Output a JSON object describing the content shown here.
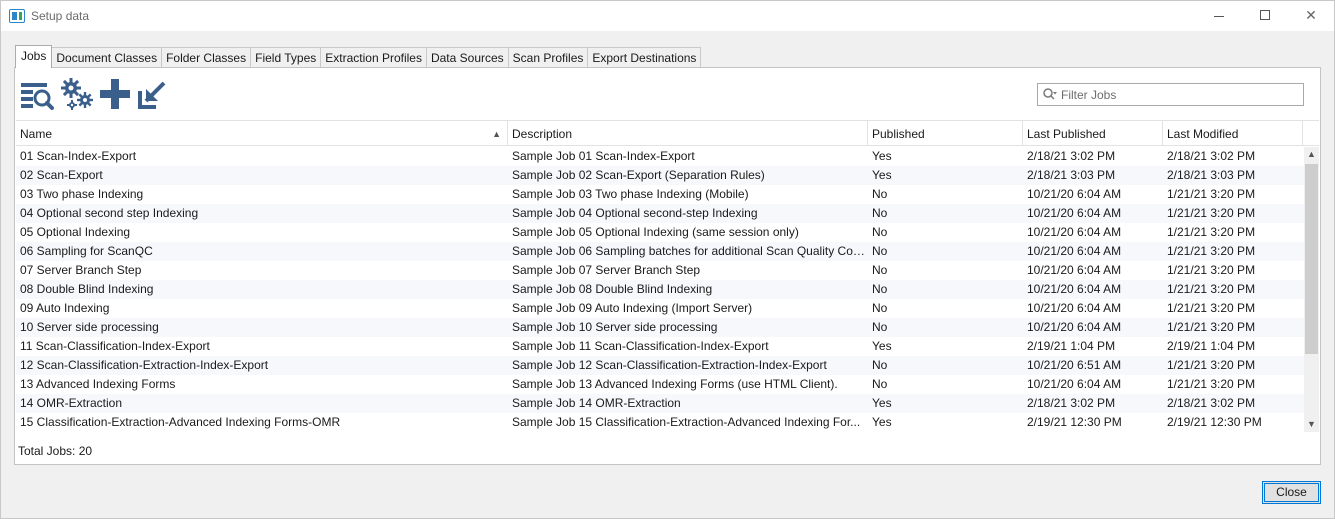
{
  "window": {
    "title": "Setup data"
  },
  "tabs": [
    {
      "label": "Jobs",
      "active": true
    },
    {
      "label": "Document Classes",
      "active": false
    },
    {
      "label": "Folder Classes",
      "active": false
    },
    {
      "label": "Field Types",
      "active": false
    },
    {
      "label": "Extraction Profiles",
      "active": false
    },
    {
      "label": "Data Sources",
      "active": false
    },
    {
      "label": "Scan Profiles",
      "active": false
    },
    {
      "label": "Export Destinations",
      "active": false
    }
  ],
  "toolbar": {
    "icons": [
      "search-list-icon",
      "settings-gears-icon",
      "add-plus-icon",
      "export-arrow-icon"
    ],
    "accent_color": "#3a5f8a"
  },
  "filter": {
    "placeholder": "Filter Jobs",
    "value": ""
  },
  "grid": {
    "columns": [
      "Name",
      "Description",
      "Published",
      "Last Published",
      "Last Modified"
    ],
    "sorted_column": "Name",
    "sort_direction": "ascending",
    "rows": [
      [
        "01 Scan-Index-Export",
        "Sample Job 01 Scan-Index-Export",
        "Yes",
        "2/18/21 3:02 PM",
        "2/18/21 3:02 PM"
      ],
      [
        "02 Scan-Export",
        "Sample Job 02 Scan-Export (Separation Rules)",
        "Yes",
        "2/18/21 3:03 PM",
        "2/18/21 3:03 PM"
      ],
      [
        "03 Two phase Indexing",
        "Sample Job 03 Two phase Indexing (Mobile)",
        "No",
        "10/21/20 6:04 AM",
        "1/21/21 3:20 PM"
      ],
      [
        "04 Optional second step Indexing",
        "Sample Job 04 Optional second-step Indexing",
        "No",
        "10/21/20 6:04 AM",
        "1/21/21 3:20 PM"
      ],
      [
        "05 Optional Indexing",
        "Sample Job 05 Optional Indexing (same session only)",
        "No",
        "10/21/20 6:04 AM",
        "1/21/21 3:20 PM"
      ],
      [
        "06 Sampling for ScanQC",
        "Sample Job 06 Sampling batches for additional Scan Quality Con...",
        "No",
        "10/21/20 6:04 AM",
        "1/21/21 3:20 PM"
      ],
      [
        "07 Server Branch Step",
        "Sample Job 07 Server Branch Step",
        "No",
        "10/21/20 6:04 AM",
        "1/21/21 3:20 PM"
      ],
      [
        "08 Double Blind Indexing",
        "Sample Job 08 Double Blind Indexing",
        "No",
        "10/21/20 6:04 AM",
        "1/21/21 3:20 PM"
      ],
      [
        "09 Auto Indexing",
        "Sample Job 09 Auto Indexing (Import Server)",
        "No",
        "10/21/20 6:04 AM",
        "1/21/21 3:20 PM"
      ],
      [
        "10 Server side processing",
        "Sample Job 10 Server side processing",
        "No",
        "10/21/20 6:04 AM",
        "1/21/21 3:20 PM"
      ],
      [
        "11 Scan-Classification-Index-Export",
        "Sample Job 11 Scan-Classification-Index-Export",
        "Yes",
        "2/19/21 1:04 PM",
        "2/19/21 1:04 PM"
      ],
      [
        "12 Scan-Classification-Extraction-Index-Export",
        "Sample Job 12 Scan-Classification-Extraction-Index-Export",
        "No",
        "10/21/20 6:51 AM",
        "1/21/21 3:20 PM"
      ],
      [
        "13 Advanced Indexing Forms",
        "Sample Job 13 Advanced Indexing Forms (use HTML Client).",
        "No",
        "10/21/20 6:04 AM",
        "1/21/21 3:20 PM"
      ],
      [
        "14 OMR-Extraction",
        "Sample Job 14 OMR-Extraction",
        "Yes",
        "2/18/21 3:02 PM",
        "2/18/21 3:02 PM"
      ],
      [
        "15 Classification-Extraction-Advanced Indexing Forms-OMR",
        "Sample Job 15 Classification-Extraction-Advanced Indexing For...",
        "Yes",
        "2/19/21 12:30 PM",
        "2/19/21 12:30 PM"
      ]
    ]
  },
  "footer": {
    "total_jobs": "Total Jobs: 20",
    "close_label": "Close"
  }
}
